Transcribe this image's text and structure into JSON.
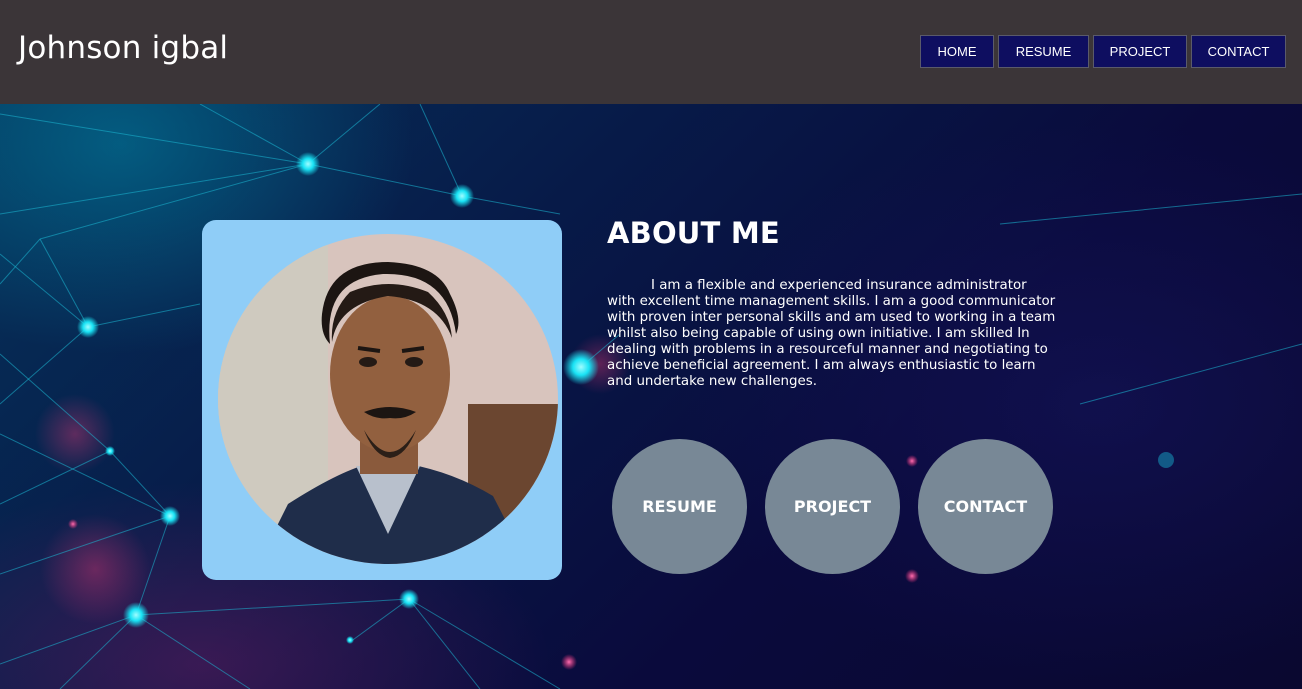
{
  "header": {
    "brand": "Johnson igbal",
    "nav": [
      {
        "label": "HOME"
      },
      {
        "label": "RESUME"
      },
      {
        "label": "PROJECT"
      },
      {
        "label": "CONTACT"
      }
    ]
  },
  "about": {
    "title": "ABOUT ME",
    "text": "I am a flexible and experienced insurance administrator with excellent time management skills. I am a good communicator with proven inter personal skills and am used to working in a team whilst also being capable of using own initiative. I am skilled In dealing with problems in a resourceful manner and negotiating to achieve beneficial agreement. I am always enthusiastic to learn and undertake new challenges."
  },
  "actions": [
    {
      "label": "RESUME"
    },
    {
      "label": "PROJECT"
    },
    {
      "label": "CONTACT"
    }
  ],
  "colors": {
    "header_bg": "#3b3538",
    "nav_button_bg": "#0e0e60",
    "photo_card_bg": "#8fcdf7",
    "circle_button_bg": "#788896",
    "network_accent": "#19e3f5"
  },
  "icons": {
    "profile_photo": "profile-photo"
  }
}
